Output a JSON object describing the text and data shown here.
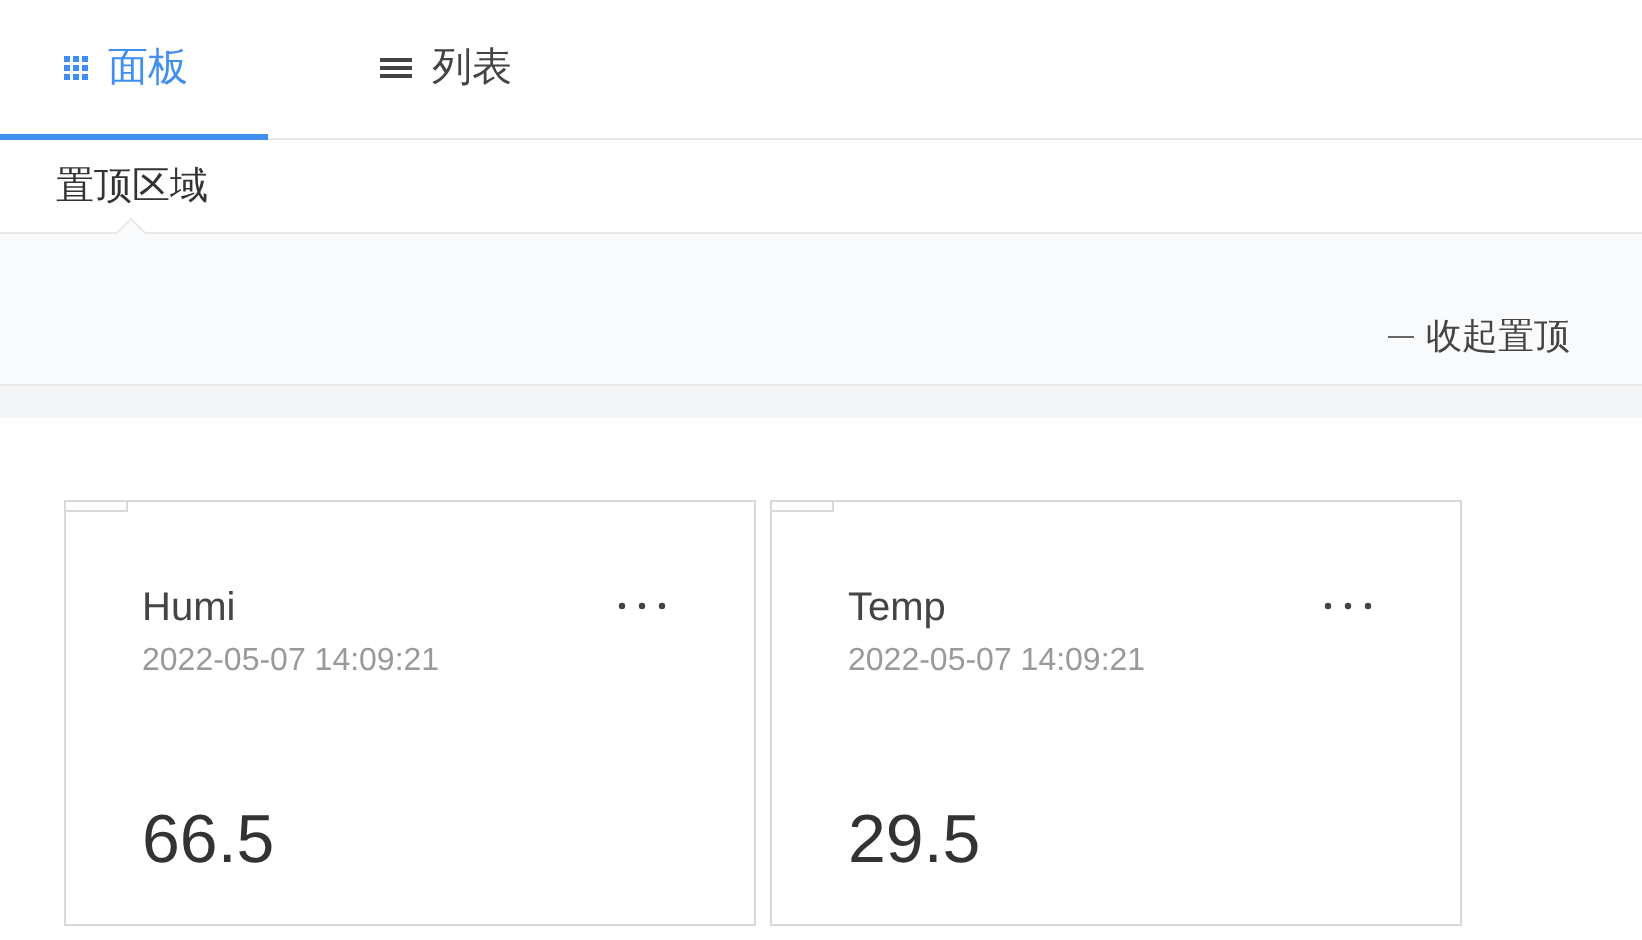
{
  "tabs": [
    {
      "label": "面板",
      "kind": "grid",
      "selected": true
    },
    {
      "label": "列表",
      "kind": "list",
      "selected": false
    }
  ],
  "pinned": {
    "label": "置顶区域",
    "collapse": "收起置顶"
  },
  "cards": [
    {
      "title": "Humi",
      "time": "2022-05-07 14:09:21",
      "value": "66.5"
    },
    {
      "title": "Temp",
      "time": "2022-05-07 14:09:21",
      "value": "29.5"
    }
  ]
}
